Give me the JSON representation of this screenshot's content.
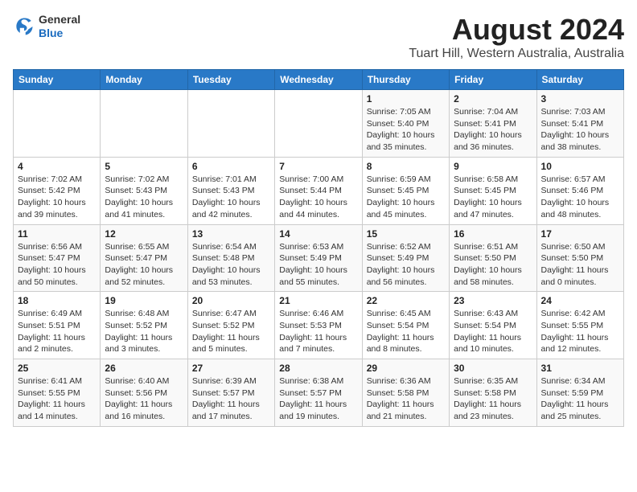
{
  "title": "August 2024",
  "subtitle": "Tuart Hill, Western Australia, Australia",
  "logo": {
    "general": "General",
    "blue": "Blue"
  },
  "days_of_week": [
    "Sunday",
    "Monday",
    "Tuesday",
    "Wednesday",
    "Thursday",
    "Friday",
    "Saturday"
  ],
  "weeks": [
    [
      {
        "day": "",
        "info": ""
      },
      {
        "day": "",
        "info": ""
      },
      {
        "day": "",
        "info": ""
      },
      {
        "day": "",
        "info": ""
      },
      {
        "day": "1",
        "info": "Sunrise: 7:05 AM\nSunset: 5:40 PM\nDaylight: 10 hours\nand 35 minutes."
      },
      {
        "day": "2",
        "info": "Sunrise: 7:04 AM\nSunset: 5:41 PM\nDaylight: 10 hours\nand 36 minutes."
      },
      {
        "day": "3",
        "info": "Sunrise: 7:03 AM\nSunset: 5:41 PM\nDaylight: 10 hours\nand 38 minutes."
      }
    ],
    [
      {
        "day": "4",
        "info": "Sunrise: 7:02 AM\nSunset: 5:42 PM\nDaylight: 10 hours\nand 39 minutes."
      },
      {
        "day": "5",
        "info": "Sunrise: 7:02 AM\nSunset: 5:43 PM\nDaylight: 10 hours\nand 41 minutes."
      },
      {
        "day": "6",
        "info": "Sunrise: 7:01 AM\nSunset: 5:43 PM\nDaylight: 10 hours\nand 42 minutes."
      },
      {
        "day": "7",
        "info": "Sunrise: 7:00 AM\nSunset: 5:44 PM\nDaylight: 10 hours\nand 44 minutes."
      },
      {
        "day": "8",
        "info": "Sunrise: 6:59 AM\nSunset: 5:45 PM\nDaylight: 10 hours\nand 45 minutes."
      },
      {
        "day": "9",
        "info": "Sunrise: 6:58 AM\nSunset: 5:45 PM\nDaylight: 10 hours\nand 47 minutes."
      },
      {
        "day": "10",
        "info": "Sunrise: 6:57 AM\nSunset: 5:46 PM\nDaylight: 10 hours\nand 48 minutes."
      }
    ],
    [
      {
        "day": "11",
        "info": "Sunrise: 6:56 AM\nSunset: 5:47 PM\nDaylight: 10 hours\nand 50 minutes."
      },
      {
        "day": "12",
        "info": "Sunrise: 6:55 AM\nSunset: 5:47 PM\nDaylight: 10 hours\nand 52 minutes."
      },
      {
        "day": "13",
        "info": "Sunrise: 6:54 AM\nSunset: 5:48 PM\nDaylight: 10 hours\nand 53 minutes."
      },
      {
        "day": "14",
        "info": "Sunrise: 6:53 AM\nSunset: 5:49 PM\nDaylight: 10 hours\nand 55 minutes."
      },
      {
        "day": "15",
        "info": "Sunrise: 6:52 AM\nSunset: 5:49 PM\nDaylight: 10 hours\nand 56 minutes."
      },
      {
        "day": "16",
        "info": "Sunrise: 6:51 AM\nSunset: 5:50 PM\nDaylight: 10 hours\nand 58 minutes."
      },
      {
        "day": "17",
        "info": "Sunrise: 6:50 AM\nSunset: 5:50 PM\nDaylight: 11 hours\nand 0 minutes."
      }
    ],
    [
      {
        "day": "18",
        "info": "Sunrise: 6:49 AM\nSunset: 5:51 PM\nDaylight: 11 hours\nand 2 minutes."
      },
      {
        "day": "19",
        "info": "Sunrise: 6:48 AM\nSunset: 5:52 PM\nDaylight: 11 hours\nand 3 minutes."
      },
      {
        "day": "20",
        "info": "Sunrise: 6:47 AM\nSunset: 5:52 PM\nDaylight: 11 hours\nand 5 minutes."
      },
      {
        "day": "21",
        "info": "Sunrise: 6:46 AM\nSunset: 5:53 PM\nDaylight: 11 hours\nand 7 minutes."
      },
      {
        "day": "22",
        "info": "Sunrise: 6:45 AM\nSunset: 5:54 PM\nDaylight: 11 hours\nand 8 minutes."
      },
      {
        "day": "23",
        "info": "Sunrise: 6:43 AM\nSunset: 5:54 PM\nDaylight: 11 hours\nand 10 minutes."
      },
      {
        "day": "24",
        "info": "Sunrise: 6:42 AM\nSunset: 5:55 PM\nDaylight: 11 hours\nand 12 minutes."
      }
    ],
    [
      {
        "day": "25",
        "info": "Sunrise: 6:41 AM\nSunset: 5:55 PM\nDaylight: 11 hours\nand 14 minutes."
      },
      {
        "day": "26",
        "info": "Sunrise: 6:40 AM\nSunset: 5:56 PM\nDaylight: 11 hours\nand 16 minutes."
      },
      {
        "day": "27",
        "info": "Sunrise: 6:39 AM\nSunset: 5:57 PM\nDaylight: 11 hours\nand 17 minutes."
      },
      {
        "day": "28",
        "info": "Sunrise: 6:38 AM\nSunset: 5:57 PM\nDaylight: 11 hours\nand 19 minutes."
      },
      {
        "day": "29",
        "info": "Sunrise: 6:36 AM\nSunset: 5:58 PM\nDaylight: 11 hours\nand 21 minutes."
      },
      {
        "day": "30",
        "info": "Sunrise: 6:35 AM\nSunset: 5:58 PM\nDaylight: 11 hours\nand 23 minutes."
      },
      {
        "day": "31",
        "info": "Sunrise: 6:34 AM\nSunset: 5:59 PM\nDaylight: 11 hours\nand 25 minutes."
      }
    ]
  ]
}
